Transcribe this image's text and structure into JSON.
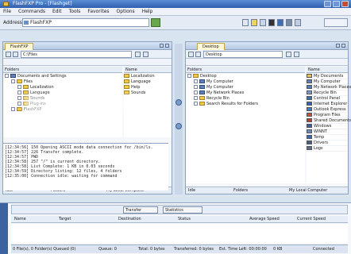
{
  "window": {
    "title": "FlashFXP Pro - [Flashget]"
  },
  "menu": [
    "File",
    "Commands",
    "Edit",
    "Tools",
    "Favorites",
    "Options",
    "Help"
  ],
  "address": {
    "label": "Address",
    "value": "FlashFXP"
  },
  "left_pane": {
    "tab": "FlashFXP",
    "path": "C:\\Files",
    "folders_header": "Folders",
    "files_header": "Name",
    "tree": [
      {
        "level": 0,
        "kind": "device",
        "label": "Documents and Settings"
      },
      {
        "level": 1,
        "kind": "folder",
        "label": "Files"
      },
      {
        "level": 2,
        "kind": "folder",
        "label": "Localization"
      },
      {
        "level": 2,
        "kind": "folder",
        "label": "Language"
      },
      {
        "level": 2,
        "kind": "folder",
        "label": "Sounds"
      },
      {
        "level": 2,
        "kind": "folder",
        "label": "Plug-ins"
      },
      {
        "level": 1,
        "kind": "folder",
        "label": "FlashFXP"
      }
    ],
    "files": [
      "Localization",
      "Language",
      "Help",
      "Sounds"
    ],
    "log": [
      "[12:34:56] 150 Opening ASCII mode data connection for /bin/ls.",
      "[12:34:57] 226 Transfer complete.",
      "[12:34:57] PWD",
      "[12:34:58] 257 \"/\" is current directory.",
      "[12:34:58] List Complete: 1 KB in 0.03 seconds",
      "[12:34:59] Directory listing: 12 files, 4 folders",
      "[12:35:00] Connection idle: waiting for command"
    ],
    "status": [
      "Idle",
      "Folders",
      "My Local Computer"
    ]
  },
  "right_pane": {
    "tab": "Desktop",
    "path": "Desktop",
    "folders_header": "Folders",
    "files_header": "Name",
    "tree": [
      {
        "level": 0,
        "kind": "folder",
        "label": "Desktop"
      },
      {
        "level": 1,
        "kind": "device",
        "label": "My Computer"
      },
      {
        "level": 1,
        "kind": "device",
        "label": "My Computer"
      },
      {
        "level": 1,
        "kind": "device",
        "label": "My Network Places"
      },
      {
        "level": 1,
        "kind": "folder",
        "label": "Recycle Bin"
      },
      {
        "level": 1,
        "kind": "folder",
        "label": "Search Results for Folders"
      }
    ],
    "files": [
      {
        "label": "My Documents",
        "color": "#e7c44a"
      },
      {
        "label": "My Computer",
        "color": "#5f80b8"
      },
      {
        "label": "My Network Places",
        "color": "#4a7cc0"
      },
      {
        "label": "Recycle Bin",
        "color": "#7e9ac6"
      },
      {
        "label": "Control Panel",
        "color": "#3f6fb0"
      },
      {
        "label": "Internet Explorer",
        "color": "#2f62c4"
      },
      {
        "label": "Outlook Express",
        "color": "#3c7bd0"
      },
      {
        "label": "Program Files",
        "color": "#d04a3a"
      },
      {
        "label": "Shared Documents",
        "color": "#c03b2c"
      },
      {
        "label": "Windows",
        "color": "#3b5ea0"
      },
      {
        "label": "WINNT",
        "color": "#6a8bc0"
      },
      {
        "label": "Temp",
        "color": "#3a66b5"
      },
      {
        "label": "Drivers",
        "color": "#4a5d82"
      },
      {
        "label": "Logs",
        "color": "#5d6e8a"
      }
    ],
    "status": [
      "Idle",
      "Folders",
      "My Local Computer"
    ]
  },
  "queue": {
    "tabs": [
      "Transfer",
      "Statistics"
    ],
    "columns": [
      "Name",
      "Target",
      "Destination",
      "Status",
      "Average Speed",
      "Current Speed"
    ]
  },
  "statusbar": [
    "0 File(s), 0 Folder(s) Queued (0)",
    "Queue: 0",
    "Total: 0 bytes",
    "Transferred: 0 bytes",
    "Est. Time Left: 00:00:00",
    "0 KB",
    "Connected"
  ]
}
